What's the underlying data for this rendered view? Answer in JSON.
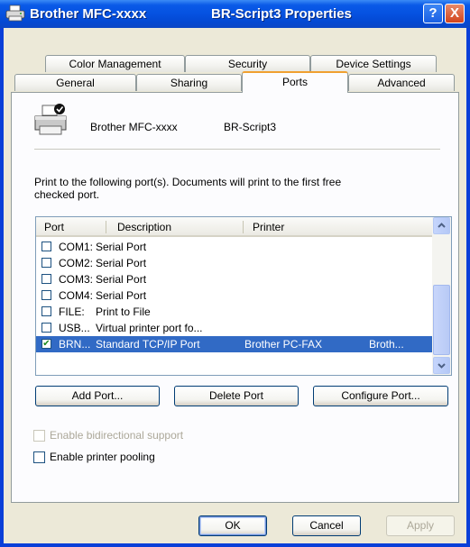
{
  "window": {
    "title_left": "Brother MFC-xxxx",
    "title_right": "BR-Script3 Properties",
    "help_label": "?",
    "close_label": "X"
  },
  "tabs": {
    "row1": [
      "Color Management",
      "Security",
      "Device Settings"
    ],
    "row2": [
      "General",
      "Sharing",
      "Ports",
      "Advanced"
    ],
    "active": "Ports"
  },
  "printer": {
    "name": "Brother MFC-xxxx",
    "driver": "BR-Script3"
  },
  "instructions": {
    "line1": "Print to the following port(s). Documents will print to the first free",
    "line2": "checked port."
  },
  "port_list": {
    "columns": [
      "Port",
      "Description",
      "Printer"
    ],
    "rows": [
      {
        "port": "COM1:",
        "description": "Serial Port",
        "printer": "",
        "extra": "",
        "checked": false,
        "selected": false
      },
      {
        "port": "COM2:",
        "description": "Serial Port",
        "printer": "",
        "extra": "",
        "checked": false,
        "selected": false
      },
      {
        "port": "COM3:",
        "description": "Serial Port",
        "printer": "",
        "extra": "",
        "checked": false,
        "selected": false
      },
      {
        "port": "COM4:",
        "description": "Serial Port",
        "printer": "",
        "extra": "",
        "checked": false,
        "selected": false
      },
      {
        "port": "FILE:",
        "description": "Print to File",
        "printer": "",
        "extra": "",
        "checked": false,
        "selected": false
      },
      {
        "port": "USB...",
        "description": "Virtual printer port fo...",
        "printer": "",
        "extra": "",
        "checked": false,
        "selected": false
      },
      {
        "port": "BRN...",
        "description": "Standard TCP/IP Port",
        "printer": "Brother PC-FAX",
        "extra": "Broth...",
        "checked": true,
        "selected": true
      }
    ],
    "checkmark": "✔"
  },
  "port_buttons": {
    "add": "Add Port...",
    "delete": "Delete Port",
    "configure": "Configure Port..."
  },
  "options": {
    "bidirectional": "Enable bidirectional support",
    "pooling": "Enable printer pooling"
  },
  "dialog_buttons": {
    "ok": "OK",
    "cancel": "Cancel",
    "apply": "Apply"
  },
  "colors": {
    "title_bar": "#0551e0",
    "selection": "#316ac5",
    "dialog_bg": "#ece9d8",
    "active_tab_accent": "#f0a030"
  }
}
